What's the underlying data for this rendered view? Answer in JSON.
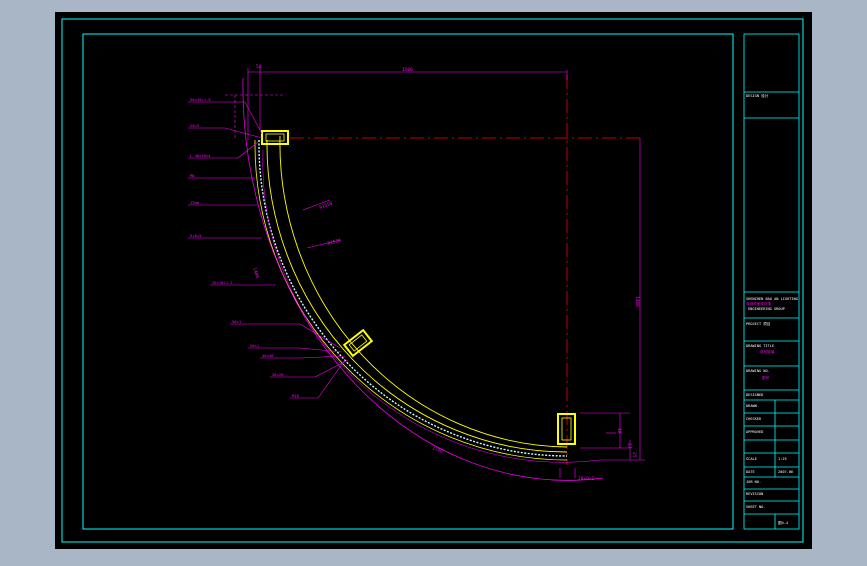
{
  "colors": {
    "background": "#a9b6c6",
    "sheet": "#000000",
    "frame": "#00ffff",
    "dimension": "#ff00ff",
    "profile": "#ffff00",
    "centerline": "#ff0000",
    "glass": "#c8ffff"
  },
  "dimensions": {
    "top_width": "1500",
    "right_height": "1400",
    "arc_length": "1700",
    "left_arc": "1400",
    "radius_outer": "R1550",
    "radius_inner": "R1520",
    "top_small": "50",
    "bottom_right_1": "48",
    "bottom_right_2": "27",
    "bottom_right_3": "25",
    "bottom_label": "20×9×1"
  },
  "callouts": [
    "50×35×1.5",
    "20×5",
    "L  40×40×4",
    "M8",
    "12mm",
    "5+6+5",
    "20×10×1.2",
    "50×1",
    "50×1",
    "40×40",
    "30×20",
    "M10"
  ],
  "title_block": {
    "header": "DESIGN 设计",
    "company_en": "SHENZHEN BAO AN LIGHTING",
    "company_cn": "深圳市宝安灯饰",
    "company_sub": "ENGINEERING GROUP",
    "project": "PROJECT  项目",
    "drawing_title": "DRAWING TITLE",
    "drawing_title_2": "弧形玻璃",
    "drawing_no": "DRAWING NO.",
    "drawing_no_2": "图号",
    "designed": "DESIGNED",
    "drawn": "DRAWN",
    "checked": "CHECKED",
    "approved": "APPROVED",
    "scale_label": "SCALE",
    "scale_value": "1:25",
    "date_label": "DATE",
    "date_value": "2007.06",
    "job_no": "JOB NO.",
    "revision": "REVISION",
    "sheet_no": "SHEET NO.",
    "sheet_value": "图4-4"
  }
}
